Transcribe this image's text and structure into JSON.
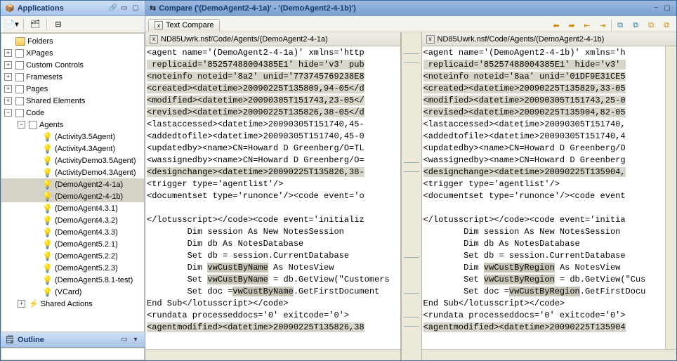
{
  "left": {
    "apps": {
      "title": "Applications",
      "tree": [
        {
          "twist": "none",
          "indent": 0,
          "icon": "folder",
          "label": "Folders"
        },
        {
          "twist": "plus",
          "indent": 0,
          "icon": "doc",
          "label": "XPages"
        },
        {
          "twist": "plus",
          "indent": 0,
          "icon": "doc",
          "label": "Custom Controls"
        },
        {
          "twist": "plus",
          "indent": 0,
          "icon": "doc",
          "label": "Framesets"
        },
        {
          "twist": "plus",
          "indent": 0,
          "icon": "doc",
          "label": "Pages"
        },
        {
          "twist": "plus",
          "indent": 0,
          "icon": "doc",
          "label": "Shared Elements"
        },
        {
          "twist": "minus",
          "indent": 0,
          "icon": "doc",
          "label": "Code"
        },
        {
          "twist": "minus",
          "indent": 1,
          "icon": "doc",
          "label": "Agents"
        },
        {
          "twist": "none",
          "indent": 2,
          "icon": "bulb",
          "label": "(Activity3.5Agent)"
        },
        {
          "twist": "none",
          "indent": 2,
          "icon": "bulb",
          "label": "(Activity4.3Agent)"
        },
        {
          "twist": "none",
          "indent": 2,
          "icon": "bulb",
          "label": "(ActivityDemo3.5Agent)"
        },
        {
          "twist": "none",
          "indent": 2,
          "icon": "bulb",
          "label": "(ActivityDemo4.3Agent)"
        },
        {
          "twist": "none",
          "indent": 2,
          "icon": "bulb",
          "label": "(DemoAgent2-4-1a)",
          "sel": true
        },
        {
          "twist": "none",
          "indent": 2,
          "icon": "bulb",
          "label": "(DemoAgent2-4-1b)",
          "sel": true
        },
        {
          "twist": "none",
          "indent": 2,
          "icon": "bulb",
          "label": "(DemoAgent4.3.1)"
        },
        {
          "twist": "none",
          "indent": 2,
          "icon": "bulb",
          "label": "(DemoAgent4.3.2)"
        },
        {
          "twist": "none",
          "indent": 2,
          "icon": "bulb",
          "label": "(DemoAgent4.3.3)"
        },
        {
          "twist": "none",
          "indent": 2,
          "icon": "bulb",
          "label": "(DemoAgent5.2.1)"
        },
        {
          "twist": "none",
          "indent": 2,
          "icon": "bulb",
          "label": "(DemoAgent5.2.2)"
        },
        {
          "twist": "none",
          "indent": 2,
          "icon": "bulb",
          "label": "(DemoAgent5.2.3)"
        },
        {
          "twist": "none",
          "indent": 2,
          "icon": "bulb",
          "label": "(DemoAgent5.8.1-test)"
        },
        {
          "twist": "none",
          "indent": 2,
          "icon": "bulb",
          "label": "(VCard)"
        },
        {
          "twist": "plus",
          "indent": 1,
          "icon": "bolt",
          "label": "Shared Actions"
        }
      ]
    },
    "outline": {
      "title": "Outline"
    }
  },
  "compare": {
    "title": "Compare ('(DemoAgent2-4-1a)' - '(DemoAgent2-4-1b)')",
    "tab_label": "Text Compare",
    "left": {
      "path": "ND85Uwrk.nsf/Code/Agents/(DemoAgent2-4-1a)",
      "lines": [
        {
          "t": "<agent name='(DemoAgent2-4-1a)' xmlns='http"
        },
        {
          "t": " replicaid='85257488004385E1' hide='v3' pub",
          "diff": "line"
        },
        {
          "t": "<noteinfo noteid='8a2' unid='773745769238E8",
          "diff": "line"
        },
        {
          "t": "<created><datetime>20090225T135809,94-05</d",
          "diff": "line"
        },
        {
          "t": "<modified><datetime>20090305T151743,23-05</",
          "diff": "line"
        },
        {
          "t": "<revised><datetime>20090225T135826,38-05</d",
          "diff": "line"
        },
        {
          "t": "<lastaccessed><datetime>20090305T151740,45-"
        },
        {
          "t": "<addedtofile><datetime>20090305T151740,45-0"
        },
        {
          "t": "<updatedby><name>CN=Howard D Greenberg/O=TL"
        },
        {
          "t": "<wassignedby><name>CN=Howard D Greenberg/O="
        },
        {
          "t": "<designchange><datetime>20090225T135826,38-",
          "diff": "line"
        },
        {
          "t": "<trigger type='agentlist'/>"
        },
        {
          "t": "<documentset type='runonce'/><code event='o"
        },
        {
          "t": ""
        },
        {
          "t": "</lotusscript></code><code event='initializ"
        },
        {
          "t": "\tDim session As New NotesSession"
        },
        {
          "t": "\tDim db As NotesDatabase"
        },
        {
          "t": "\tSet db = session.CurrentDatabase"
        },
        {
          "t": "\tDim vwCustByName As NotesView",
          "diff": "word",
          "word": "vwCustByName"
        },
        {
          "t": "\tSet vwCustByName = db.GetView(\"Customers",
          "diff": "word",
          "word": "vwCustByName"
        },
        {
          "t": "\tSet doc =vwCustByName.GetFirstDocument",
          "diff": "word",
          "word": "vwCustByName"
        },
        {
          "t": "End Sub</lotusscript></code>"
        },
        {
          "t": "<rundata processeddocs='0' exitcode='0'>"
        },
        {
          "t": "<agentmodified><datetime>20090225T135826,38",
          "diff": "line"
        }
      ]
    },
    "right": {
      "path": "ND85Uwrk.nsf/Code/Agents/(DemoAgent2-4-1b)",
      "lines": [
        {
          "t": "<agent name='(DemoAgent2-4-1b)' xmlns='h"
        },
        {
          "t": " replicaid='85257488004385E1' hide='v3' ",
          "diff": "line"
        },
        {
          "t": "<noteinfo noteid='8aa' unid='01DF9E31CE5",
          "diff": "line"
        },
        {
          "t": "<created><datetime>20090225T135829,33-05",
          "diff": "line"
        },
        {
          "t": "<modified><datetime>20090305T151743,25-0",
          "diff": "line"
        },
        {
          "t": "<revised><datetime>20090225T135904,82-05",
          "diff": "line"
        },
        {
          "t": "<lastaccessed><datetime>20090305T151740,"
        },
        {
          "t": "<addedtofile><datetime>20090305T151740,4"
        },
        {
          "t": "<updatedby><name>CN=Howard D Greenberg/O"
        },
        {
          "t": "<wassignedby><name>CN=Howard D Greenberg"
        },
        {
          "t": "<designchange><datetime>20090225T135904,",
          "diff": "line"
        },
        {
          "t": "<trigger type='agentlist'/>"
        },
        {
          "t": "<documentset type='runonce'/><code event"
        },
        {
          "t": ""
        },
        {
          "t": "</lotusscript></code><code event='initia"
        },
        {
          "t": "\tDim session As New NotesSession"
        },
        {
          "t": "\tDim db As NotesDatabase"
        },
        {
          "t": "\tSet db = session.CurrentDatabase"
        },
        {
          "t": "\tDim vwCustByRegion As NotesView",
          "diff": "word",
          "word": "vwCustByRegion"
        },
        {
          "t": "\tSet vwCustByRegion = db.GetView(\"Cus",
          "diff": "word",
          "word": "vwCustByRegion"
        },
        {
          "t": "\tSet doc =vwCustByRegion.GetFirstDocu",
          "diff": "word",
          "word": "vwCustByRegion"
        },
        {
          "t": "End Sub</lotusscript></code>"
        },
        {
          "t": "<rundata processeddocs='0' exitcode='0'>"
        },
        {
          "t": "<agentmodified><datetime>20090225T135904",
          "diff": "line"
        }
      ]
    }
  }
}
